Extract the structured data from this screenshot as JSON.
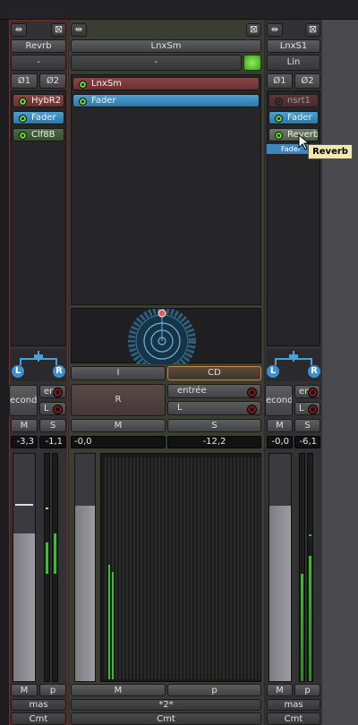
{
  "strips": [
    {
      "name": "Revrb",
      "input": "-",
      "phase1": "Ø1",
      "phase2": "Ø2",
      "plugins": [
        {
          "label": "HybR2",
          "color": "red",
          "led": "on"
        },
        {
          "label": "Fader",
          "color": "blue",
          "led": "on"
        },
        {
          "label": "Clf8B",
          "color": "green",
          "led": "on"
        }
      ],
      "pan_l": "L",
      "pan_r": "R",
      "io_in": "econd",
      "io_route": "en",
      "io_l": "L",
      "mute": "M",
      "solo": "S",
      "gain": "-3,3",
      "peak": "-1,1",
      "meter_point": "M",
      "mode": "p",
      "group": "mas",
      "comment": "Cmt",
      "fader_level": 0.65
    },
    {
      "name": "LnxSm",
      "input": "-",
      "plugins": [
        {
          "label": "LnxSm",
          "color": "red",
          "led": "on"
        },
        {
          "label": "Fader",
          "color": "blue",
          "led": "on"
        }
      ],
      "btn_i": "I",
      "btn_cd": "CD",
      "btn_r": "R",
      "io_route": "entrée",
      "io_l": "L",
      "mute": "M",
      "solo": "S",
      "gain": "-0,0",
      "peak": "-12,2",
      "meter_point": "M",
      "mode": "p",
      "group": "*2*",
      "comment": "Cmt",
      "fader_level": 0.77
    },
    {
      "name": "LnxS1",
      "input": "Lin",
      "phase1": "Ø1",
      "phase2": "Ø2",
      "plugins": [
        {
          "label": "nsrt1",
          "color": "red",
          "led": "off"
        },
        {
          "label": "Fader",
          "color": "blue",
          "led": "on"
        },
        {
          "label": "Reverb",
          "color": "green",
          "led": "on"
        }
      ],
      "drag_label": "Fader",
      "tooltip": "Reverb",
      "pan_l": "L",
      "pan_r": "R",
      "io_in": "econd",
      "io_route": "en",
      "io_l": "L",
      "mute": "M",
      "solo": "S",
      "gain": "-0,0",
      "peak": "-6,1",
      "meter_point": "M",
      "mode": "p",
      "group": "mas",
      "comment": "Cmt",
      "fader_level": 0.77
    }
  ],
  "colors": {
    "accent_green": "#6fdc3a",
    "strip_border_red": "#8a2222",
    "cd_border": "#d08a3a",
    "tooltip_bg": "#f3e9a8"
  },
  "icons": {
    "width_toggle": "arrows-horizontal-icon",
    "close": "close-icon",
    "cursor": "mouse-pointer-icon"
  }
}
